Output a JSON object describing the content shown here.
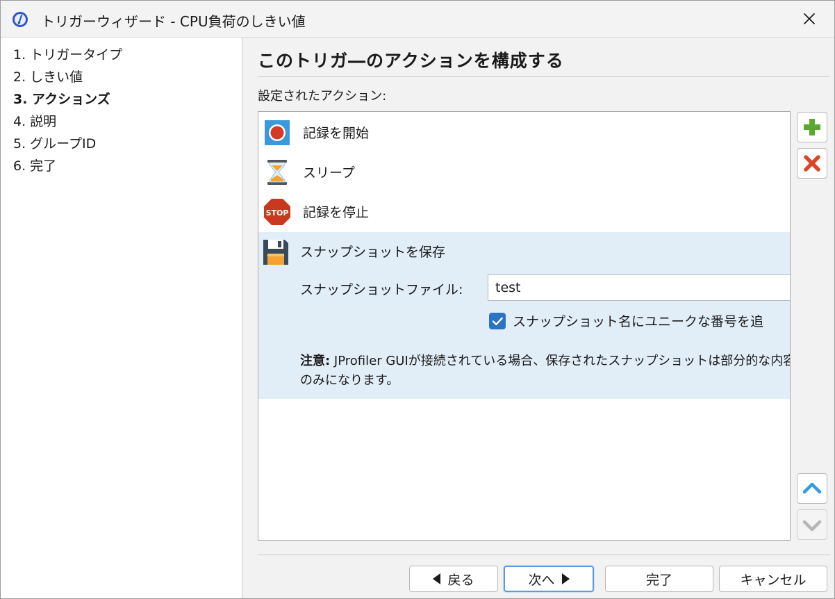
{
  "window": {
    "title": "トリガーウィザード - CPU負荷のしきい値"
  },
  "sidebar": {
    "steps": [
      {
        "label": "1. トリガータイプ"
      },
      {
        "label": "2. しきい値"
      },
      {
        "label": "3. アクションズ",
        "current": true
      },
      {
        "label": "4. 説明"
      },
      {
        "label": "5. グループID"
      },
      {
        "label": "6. 完了"
      }
    ]
  },
  "main": {
    "heading": "このトリガ―のアクションを構成する",
    "configured_label": "設定されたアクション:",
    "actions": [
      {
        "label": "記録を開始",
        "icon": "record-start-icon"
      },
      {
        "label": "スリープ",
        "icon": "hourglass-icon"
      },
      {
        "label": "記録を停止",
        "icon": "stop-sign-icon"
      },
      {
        "label": "スナップショットを保存",
        "icon": "floppy-disk-icon",
        "selected": true
      }
    ],
    "snapshot": {
      "file_label": "スナップショットファイル:",
      "file_value": "test",
      "unique_checkbox_label": "スナップショット名にユニークな番号を追",
      "unique_checked": true,
      "note_bold": "注意:",
      "note_text": " JProfiler GUIが接続されている場合、保存されたスナップショットは部分的な内容のみになります。"
    },
    "side_buttons": {
      "add": "plus-icon",
      "remove": "delete-icon",
      "move_up": "arrow-up-icon",
      "move_down": "arrow-down-icon"
    }
  },
  "footer": {
    "back_label": "戻る",
    "next_label": "次へ",
    "finish_label": "完了",
    "cancel_label": "キャンセル"
  },
  "colors": {
    "selection": "#e1edf7",
    "accent": "#2d73c4",
    "add_green": "#5aa832",
    "remove_red": "#d9472b"
  }
}
